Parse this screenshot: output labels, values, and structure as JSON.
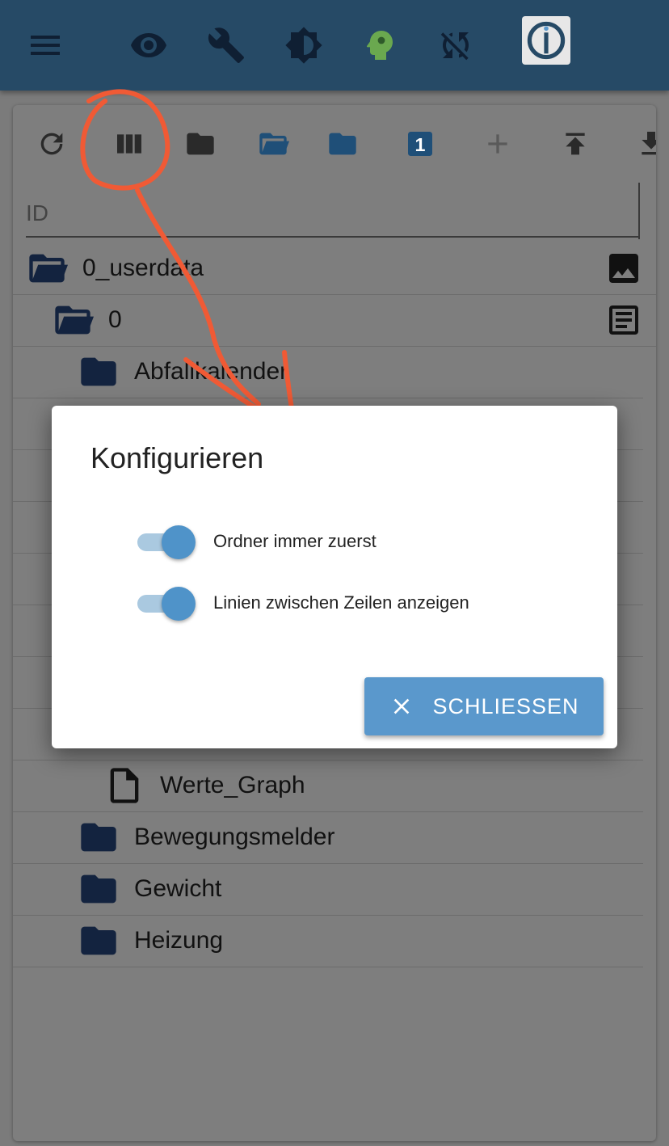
{
  "colors": {
    "appbar": "#264a66",
    "accent": "#5a98cc",
    "folder_dark": "#13233f",
    "annotation": "#f05a35"
  },
  "appbar": {
    "icons": [
      "menu-icon",
      "eye-icon",
      "wrench-icon",
      "brightness-icon",
      "expert-head-icon",
      "sync-disabled-icon",
      "iobroker-logo"
    ]
  },
  "toolbar": {
    "icons": [
      "refresh-icon",
      "columns-icon",
      "folder-icon",
      "folder-open-icon",
      "folder-blue-icon",
      "number-one-icon",
      "add-icon",
      "upload-icon",
      "download-icon"
    ],
    "badge_number": "1"
  },
  "table": {
    "id_header": "ID"
  },
  "tree": [
    {
      "label": "0_userdata",
      "level": 0,
      "icon": "folder-open-icon",
      "right_icon": "image-icon"
    },
    {
      "label": "0",
      "level": 1,
      "icon": "folder-open-icon",
      "right_icon": "document-icon"
    },
    {
      "label": "Abfallkalender",
      "level": 2,
      "icon": "folder-icon"
    },
    {
      "label": "Werte_Graph",
      "level": 3,
      "icon": "file-icon"
    },
    {
      "label": "Bewegungsmelder",
      "level": 2,
      "icon": "folder-icon"
    },
    {
      "label": "Gewicht",
      "level": 2,
      "icon": "folder-icon"
    },
    {
      "label": "Heizung",
      "level": 2,
      "icon": "folder-icon"
    }
  ],
  "dialog": {
    "title": "Konfigurieren",
    "options": [
      {
        "label": "Ordner immer zuerst",
        "enabled": true
      },
      {
        "label": "Linien zwischen Zeilen anzeigen",
        "enabled": true
      }
    ],
    "close_label": "SCHLIESSEN"
  }
}
